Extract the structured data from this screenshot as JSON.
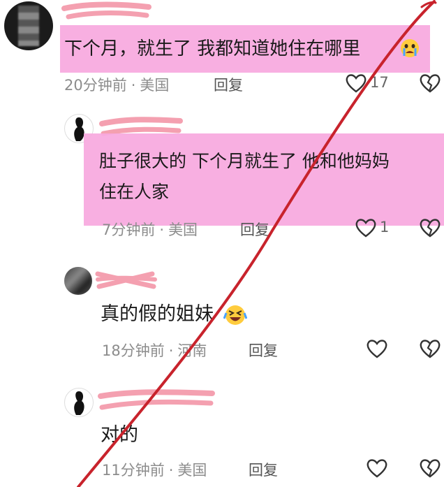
{
  "comments": [
    {
      "text": "下个月，就生了 我都知道她住在哪里",
      "emoji": "crying-face",
      "time": "20分钟前",
      "location": "美国",
      "reply_label": "回复",
      "likes": "17"
    },
    {
      "text_line1": "肚子很大的 下个月就生了 他和他妈妈",
      "text_line2": "住在人家",
      "time": "7分钟前",
      "location": "美国",
      "reply_label": "回复",
      "likes": "1"
    },
    {
      "text": "真的假的姐妹",
      "emoji": "rolling-laughing-face",
      "time": "18分钟前",
      "location": "河南",
      "reply_label": "回复"
    },
    {
      "text": "对的",
      "time": "11分钟前",
      "location": "美国",
      "reply_label": "回复"
    }
  ],
  "colors": {
    "highlight": "#f7a8de",
    "redline": "#c8232c",
    "scribble": "#f4a0b0"
  },
  "icons": [
    "like-heart-icon",
    "dislike-broken-heart-icon",
    "crying-face-emoji",
    "rolling-laughing-emoji"
  ]
}
